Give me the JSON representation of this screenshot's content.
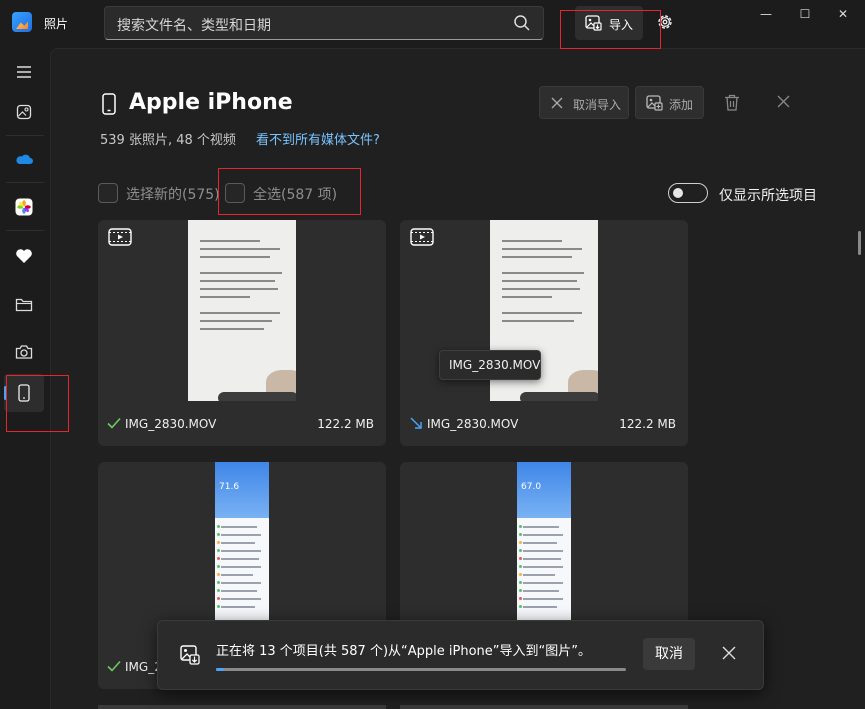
{
  "app": {
    "title": "照片"
  },
  "search": {
    "placeholder": "搜索文件名、类型和日期"
  },
  "toolbar": {
    "import_label": "导入"
  },
  "window_controls": {
    "minimize": "—",
    "maximize": "☐",
    "close": "✕"
  },
  "sidebar": {
    "items": [
      {
        "name": "menu",
        "icon": "hamburger-icon"
      },
      {
        "name": "gallery",
        "icon": "gallery-icon"
      },
      {
        "name": "onedrive",
        "icon": "cloud-icon"
      },
      {
        "name": "icloud-photos",
        "icon": "icloud-photos-icon"
      },
      {
        "name": "favorites",
        "icon": "heart-icon"
      },
      {
        "name": "folders",
        "icon": "folder-icon"
      },
      {
        "name": "camera",
        "icon": "camera-icon"
      },
      {
        "name": "apple-iphone",
        "icon": "phone-icon",
        "active": true
      }
    ]
  },
  "header": {
    "device_name": "Apple iPhone",
    "summary": "539 张照片, 48 个视频",
    "missing_media_link": "看不到所有媒体文件?",
    "cancel_import_label": "取消导入",
    "add_label": "添加"
  },
  "selection": {
    "select_new_label": "选择新的(575)",
    "select_all_label": "全选(587 项)",
    "show_selected_only_label": "仅显示所选项目"
  },
  "items": [
    {
      "filename": "IMG_2830.MOV",
      "size": "122.2 MB",
      "type": "video",
      "status": "imported"
    },
    {
      "filename": "IMG_2830.MOV",
      "size": "122.2 MB",
      "type": "video",
      "status": "importing",
      "tooltip": "IMG_2830.MOV"
    },
    {
      "filename": "IMG_2",
      "size": "",
      "type": "photo",
      "status": "imported",
      "thumb_text": "71.6"
    },
    {
      "filename": "",
      "size": "",
      "type": "photo",
      "status": "",
      "thumb_text": "67.0"
    }
  ],
  "import_progress": {
    "message": "正在将 13 个项目(共 587 个)从“Apple iPhone”导入到“图片”。",
    "cancel_label": "取消",
    "progress": 0.02
  },
  "colors": {
    "accent": "#4aa3f5",
    "link": "#79c3ff",
    "highlight": "#e0282e",
    "check": "#6ccb5f"
  }
}
